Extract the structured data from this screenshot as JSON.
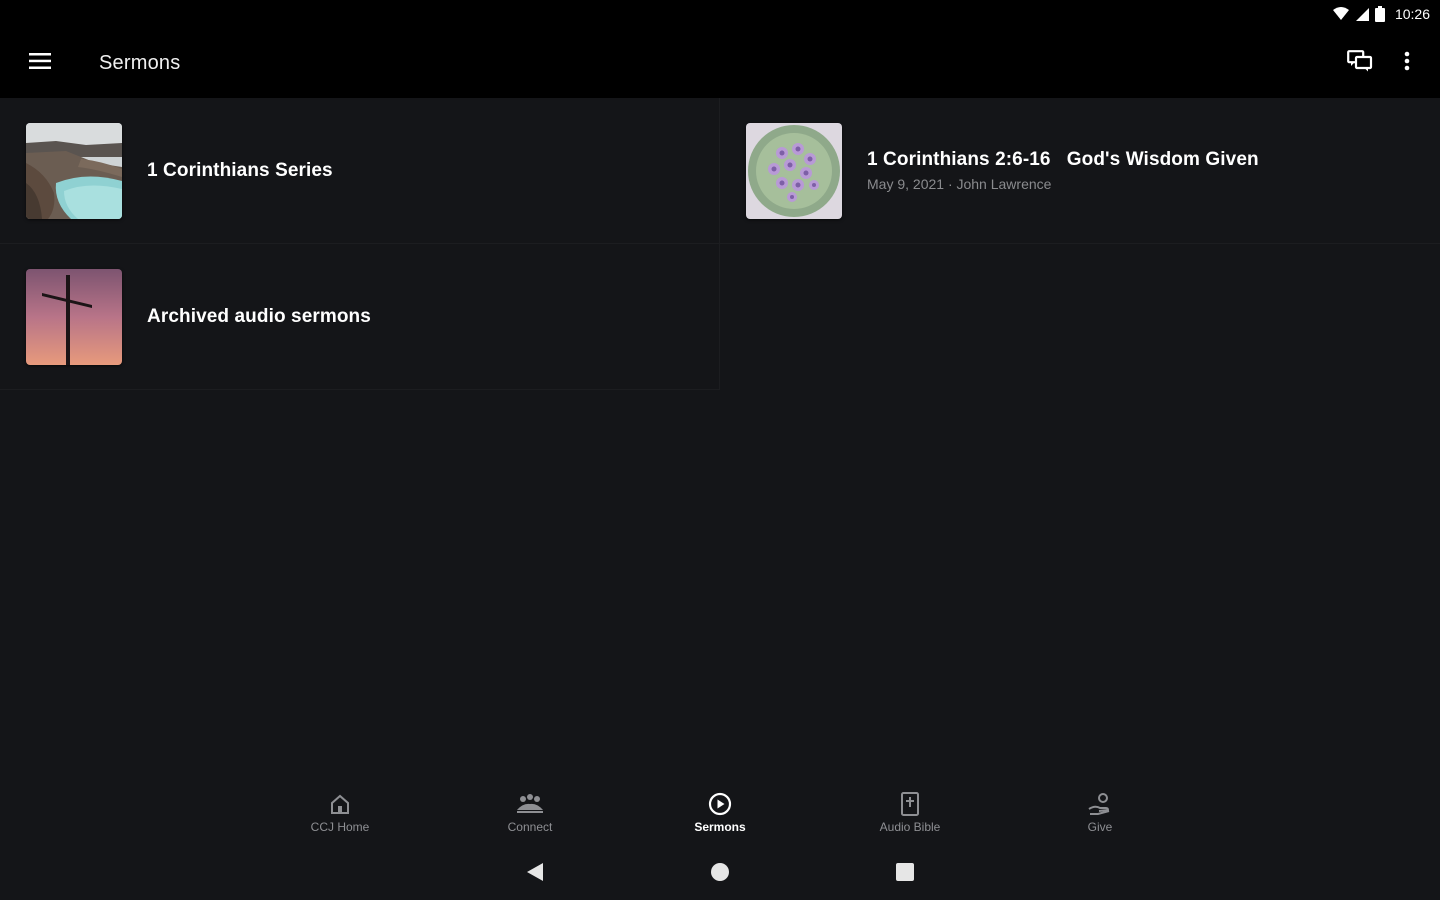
{
  "status_bar": {
    "time": "10:26"
  },
  "app_bar": {
    "title": "Sermons"
  },
  "items": [
    {
      "title": "1 Corinthians Series",
      "subtitle": "",
      "thumbnail": "coastal-cliffs-image"
    },
    {
      "title": "1 Corinthians 2:6-16   God's Wisdom Given",
      "subtitle": "May 9, 2021 · John Lawrence",
      "thumbnail": "purple-flowers-image"
    },
    {
      "title": "Archived audio sermons",
      "subtitle": "",
      "thumbnail": "cross-sunset-image"
    }
  ],
  "bottom_nav": [
    {
      "label": "CCJ Home",
      "icon": "home-icon",
      "active": false
    },
    {
      "label": "Connect",
      "icon": "people-icon",
      "active": false
    },
    {
      "label": "Sermons",
      "icon": "play-circle-icon",
      "active": true
    },
    {
      "label": "Audio Bible",
      "icon": "bible-icon",
      "active": false
    },
    {
      "label": "Give",
      "icon": "give-icon",
      "active": false
    }
  ],
  "colors": {
    "background": "#141518",
    "app_bar": "#000000",
    "text_primary": "#ffffff",
    "text_secondary": "#8a8b8e"
  }
}
